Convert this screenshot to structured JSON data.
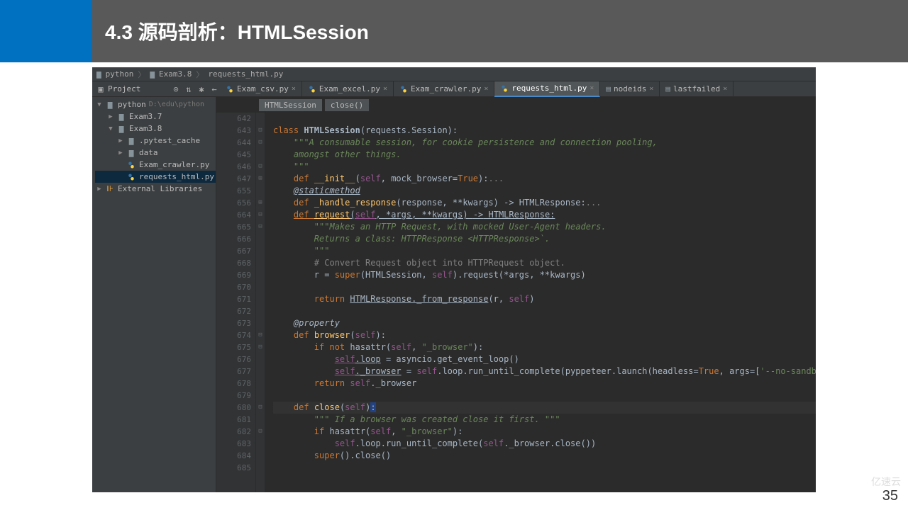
{
  "slide": {
    "title": "4.3 源码剖析：HTMLSession",
    "number": "35",
    "watermark": "亿速云"
  },
  "nav": {
    "seg1": "python",
    "seg2": "Exam3.8",
    "seg3": "requests_html.py"
  },
  "project_label": "Project",
  "tabs": [
    {
      "label": "Exam_csv.py",
      "active": false
    },
    {
      "label": "Exam_excel.py",
      "active": false
    },
    {
      "label": "Exam_crawler.py",
      "active": false
    },
    {
      "label": "requests_html.py",
      "active": true
    },
    {
      "label": "nodeids",
      "active": false
    },
    {
      "label": "lastfailed",
      "active": false
    }
  ],
  "tree": {
    "root": "python",
    "root_path": "D:\\edu\\python",
    "items": [
      {
        "indent": 1,
        "arrow": "▶",
        "icon": "folder",
        "label": "Exam3.7"
      },
      {
        "indent": 1,
        "arrow": "▼",
        "icon": "folder",
        "label": "Exam3.8"
      },
      {
        "indent": 2,
        "arrow": "▶",
        "icon": "folder",
        "label": ".pytest_cache"
      },
      {
        "indent": 2,
        "arrow": "▶",
        "icon": "folder",
        "label": "data"
      },
      {
        "indent": 2,
        "arrow": "",
        "icon": "py",
        "label": "Exam_crawler.py"
      },
      {
        "indent": 2,
        "arrow": "",
        "icon": "py",
        "label": "requests_html.py",
        "selected": true
      }
    ],
    "libs": "External Libraries"
  },
  "crumbs": {
    "c1": "HTMLSession",
    "c2": "close()"
  },
  "code": {
    "lines": [
      {
        "n": 642,
        "html": ""
      },
      {
        "n": 643,
        "fm": "⊟",
        "html": "<span class='kw'>class </span><span class='cls'>HTMLSession</span><span class='par'>(requests.Session):</span>"
      },
      {
        "n": 644,
        "fm": "⊟",
        "html": "    <span class='str'>\"\"\"A consumable session, for cookie persistence and connection pooling,</span>"
      },
      {
        "n": 645,
        "html": "    <span class='str'>amongst other things.</span>"
      },
      {
        "n": 646,
        "fm": "⊟",
        "html": "    <span class='str'>\"\"\"</span>"
      },
      {
        "n": 647,
        "fm": "⊞",
        "html": "    <span class='kw'>def </span><span class='fn'>__init__</span><span class='par'>(</span><span class='self'>self</span><span class='par'>, mock_browser=</span><span class='kw'>True</span><span class='par'>):</span><span class='cmt'>...</span>"
      },
      {
        "n": 655,
        "html": "    <span class='dec under'>@staticmethod</span>"
      },
      {
        "n": 656,
        "fm": "⊞",
        "html": "    <span class='kw'>def </span><span class='fn'>_handle_response</span><span class='par'>(response, **kwargs) </span><span class='arrow'>-&gt;</span><span class='par'> HTMLResponse:</span><span class='cmt'>...</span>"
      },
      {
        "n": 664,
        "bp": true,
        "fm": "⊟",
        "html": "    <span class='kw under'>def </span><span class='fn under'>request</span><span class='par under'>(</span><span class='self under'>self</span><span class='par under'>, *args, **kwargs) </span><span class='arrow under'>-&gt;</span><span class='par under'> HTMLResponse:</span>"
      },
      {
        "n": 665,
        "fm": "⊟",
        "html": "        <span class='str'>\"\"\"Makes an HTTP Request, with mocked User‑Agent headers.</span>"
      },
      {
        "n": 666,
        "html": "        <span class='str'>Returns a class: HTTPResponse &lt;HTTPResponse&gt;`.</span>"
      },
      {
        "n": 667,
        "html": "        <span class='str'>\"\"\"</span>"
      },
      {
        "n": 668,
        "html": "        <span class='cmt'># Convert Request object into HTTPRequest object.</span>"
      },
      {
        "n": 669,
        "html": "        <span class='txt'>r = </span><span class='builtin'>super</span><span class='txt'>(HTMLSession, </span><span class='self'>self</span><span class='txt'>).request(*args, **kwargs)</span>"
      },
      {
        "n": 670,
        "html": ""
      },
      {
        "n": 671,
        "html": "        <span class='kw'>return </span><span class='txt under'>HTMLResponse._from_response</span><span class='txt'>(r, </span><span class='self'>self</span><span class='txt'>)</span>"
      },
      {
        "n": 672,
        "html": ""
      },
      {
        "n": 673,
        "html": "    <span class='dec'>@property</span>"
      },
      {
        "n": 674,
        "fm": "⊟",
        "html": "    <span class='kw'>def </span><span class='fn'>browser</span><span class='par'>(</span><span class='self'>self</span><span class='par'>):</span>"
      },
      {
        "n": 675,
        "fm": "⊟",
        "html": "        <span class='kw'>if not </span><span class='txt'>hasattr(</span><span class='self'>self</span><span class='txt'>, </span><span class='strn'>\"_browser\"</span><span class='txt'>):</span>"
      },
      {
        "n": 676,
        "html": "            <span class='self under'>self</span><span class='txt under'>.loop</span><span class='txt'> = asyncio.get_event_loop()</span>"
      },
      {
        "n": 677,
        "html": "            <span class='self under'>self</span><span class='txt under'>._browser</span><span class='txt'> = </span><span class='self'>self</span><span class='txt'>.loop.run_until_complete(pyppeteer.launch(</span><span class='par'>headless</span><span class='txt'>=</span><span class='kw'>True</span><span class='txt'>, </span><span class='par'>args</span><span class='txt'>=[</span><span class='strn'>'--no-sandbox'</span><span class='txt'>]))</span>"
      },
      {
        "n": 678,
        "html": "        <span class='kw'>return </span><span class='self'>self</span><span class='txt'>._browser</span>"
      },
      {
        "n": 679,
        "html": ""
      },
      {
        "n": 680,
        "bp": true,
        "fm": "⊟",
        "hl": true,
        "html": "    <span class='kw'>def </span><span class='fn'>close</span><span class='par'>(</span><span class='self'>self</span><span class='par'>)</span><span class='caret-bg'>:</span>"
      },
      {
        "n": 681,
        "html": "        <span class='str'>\"\"\" If a browser was created close it first. \"\"\"</span>"
      },
      {
        "n": 682,
        "fm": "⊟",
        "html": "        <span class='kw'>if </span><span class='txt'>hasattr(</span><span class='self'>self</span><span class='txt'>, </span><span class='strn'>\"_browser\"</span><span class='txt'>):</span>"
      },
      {
        "n": 683,
        "html": "            <span class='self'>self</span><span class='txt'>.loop.run_until_complete(</span><span class='self'>self</span><span class='txt'>._browser.close())</span>"
      },
      {
        "n": 684,
        "html": "        <span class='builtin'>super</span><span class='txt'>().close()</span>"
      },
      {
        "n": 685,
        "html": ""
      }
    ]
  }
}
